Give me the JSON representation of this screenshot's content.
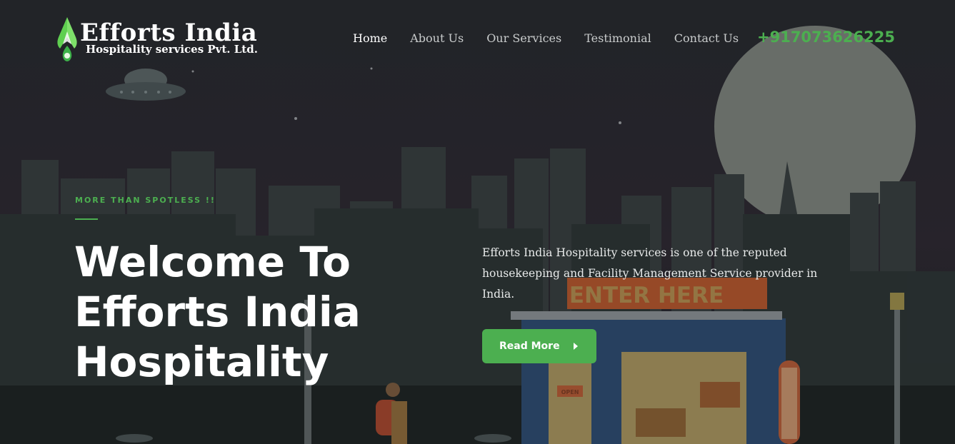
{
  "brand": {
    "name": "Efforts India",
    "tagline": "Hospitality services Pvt. Ltd.",
    "icon": "leaf-drop-icon"
  },
  "nav": {
    "items": [
      {
        "label": "Home",
        "active": true
      },
      {
        "label": "About Us",
        "active": false
      },
      {
        "label": "Our Services",
        "active": false
      },
      {
        "label": "Testimonial",
        "active": false
      },
      {
        "label": "Contact Us",
        "active": false
      }
    ],
    "phone": "+917073626225"
  },
  "hero": {
    "eyebrow": "MORE THAN SPOTLESS !!",
    "title_lines": [
      "Welcome To",
      "Efforts India",
      "Hospitality"
    ],
    "description": "Efforts India Hospitality services is one of the reputed housekeeping and Facility Management Service provider in India.",
    "button_label": "Read More",
    "sign_text": "ENTER HERE",
    "door_sign": "OPEN"
  },
  "colors": {
    "accent": "#4caf50",
    "background": "#1f2424",
    "sky": "#2a2630",
    "moon": "#7c807b"
  }
}
